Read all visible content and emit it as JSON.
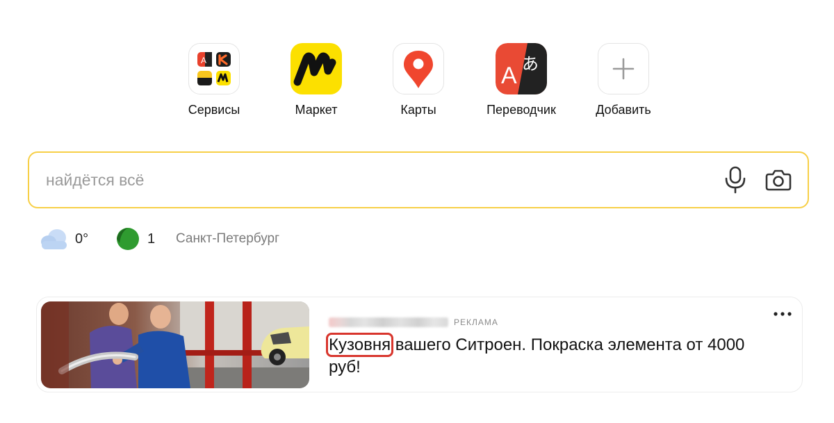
{
  "services": {
    "items": [
      {
        "label": "Сервисы",
        "icon": "services-grid-icon"
      },
      {
        "label": "Маркет",
        "icon": "market-icon"
      },
      {
        "label": "Карты",
        "icon": "maps-pin-icon"
      },
      {
        "label": "Переводчик",
        "icon": "translator-icon"
      },
      {
        "label": "Добавить",
        "icon": "plus-icon"
      }
    ]
  },
  "search": {
    "placeholder": "найдётся всё",
    "value": "",
    "accent_color": "#f7cf46"
  },
  "info": {
    "temperature": "0°",
    "traffic_score": "1",
    "city": "Санкт-Петербург"
  },
  "ad": {
    "badge": "РЕКЛАМА",
    "title_highlight": "Кузовня",
    "title_rest": " вашего Ситроен. Покраска элемента от 4000 руб!",
    "highlight_color": "#d8352c"
  }
}
